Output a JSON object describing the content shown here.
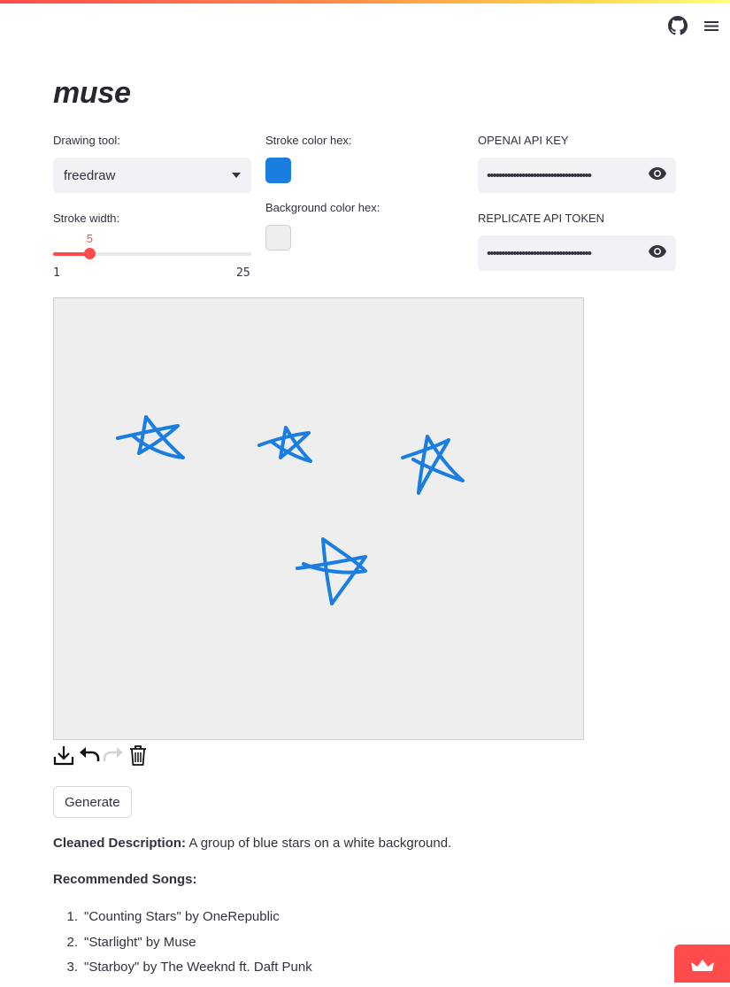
{
  "app": {
    "title": "muse"
  },
  "header": {
    "github_icon": "github-icon",
    "menu_icon": "hamburger-menu-icon"
  },
  "controls": {
    "drawing_tool": {
      "label": "Drawing tool:",
      "value": "freedraw"
    },
    "stroke_width": {
      "label": "Stroke width:",
      "value": "5",
      "value_num": 5,
      "min": "1",
      "max": "25",
      "min_num": 1,
      "max_num": 25
    },
    "stroke_color": {
      "label": "Stroke color hex:",
      "value": "#1a7de0"
    },
    "background_color": {
      "label": "Background color hex:",
      "value": "#eeeeee"
    },
    "openai_key": {
      "label": "OPENAI API KEY",
      "masked": "••••••••••••••••••••••••••••••••••••"
    },
    "replicate_token": {
      "label": "REPLICATE API TOKEN",
      "masked": "••••••••••••••••••••••••••••••••••••"
    }
  },
  "canvas": {
    "background": "#eeeeee",
    "stroke_color": "#1a7de0",
    "toolbar": [
      "download-icon",
      "undo-icon",
      "redo-icon",
      "trash-icon"
    ]
  },
  "generate_button": {
    "label": "Generate"
  },
  "result": {
    "description_label": "Cleaned Description:",
    "description_text": "A group of blue stars on a white background.",
    "songs_label": "Recommended Songs:",
    "songs": [
      {
        "num": "1.",
        "text": "\"Counting Stars\" by OneRepublic"
      },
      {
        "num": "2.",
        "text": "\"Starlight\" by Muse"
      },
      {
        "num": "3.",
        "text": "\"Starboy\" by The Weeknd ft. Daft Punk"
      }
    ]
  },
  "colors": {
    "accent": "#ff4b4b",
    "stroke": "#1a7de0"
  }
}
